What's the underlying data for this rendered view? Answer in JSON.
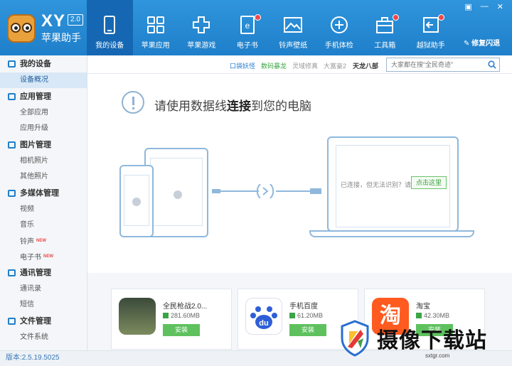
{
  "app": {
    "logo_text": "XY",
    "version_badge": "2.0",
    "name": "苹果助手",
    "fix_flash": "修复闪退"
  },
  "window_controls": [
    "▣",
    "—",
    "✕"
  ],
  "nav": [
    {
      "label": "我的设备",
      "icon": "device-icon",
      "active": true,
      "dot": false
    },
    {
      "label": "苹果应用",
      "icon": "apps-grid-icon",
      "active": false,
      "dot": false
    },
    {
      "label": "苹果游戏",
      "icon": "gamepad-icon",
      "active": false,
      "dot": false
    },
    {
      "label": "电子书",
      "icon": "ebook-icon",
      "active": false,
      "dot": true
    },
    {
      "label": "铃声壁纸",
      "icon": "wallpaper-icon",
      "active": false,
      "dot": false
    },
    {
      "label": "手机体检",
      "icon": "checkup-icon",
      "active": false,
      "dot": false
    },
    {
      "label": "工具箱",
      "icon": "toolbox-icon",
      "active": false,
      "dot": true
    },
    {
      "label": "越狱助手",
      "icon": "jailbreak-icon",
      "active": false,
      "dot": true
    }
  ],
  "sidebar": [
    {
      "title": "我的设备",
      "items": [
        {
          "label": "设备概况",
          "active": true
        }
      ]
    },
    {
      "title": "应用管理",
      "items": [
        {
          "label": "全部应用"
        },
        {
          "label": "应用升级"
        }
      ]
    },
    {
      "title": "图片管理",
      "items": [
        {
          "label": "相机照片"
        },
        {
          "label": "其他照片"
        }
      ]
    },
    {
      "title": "多媒体管理",
      "items": [
        {
          "label": "视频"
        },
        {
          "label": "音乐"
        },
        {
          "label": "铃声",
          "new": "NEW"
        },
        {
          "label": "电子书",
          "new": "NEW"
        }
      ]
    },
    {
      "title": "通讯管理",
      "items": [
        {
          "label": "通讯录"
        },
        {
          "label": "短信"
        }
      ]
    },
    {
      "title": "文件管理",
      "items": [
        {
          "label": "文件系统"
        }
      ]
    }
  ],
  "quick_links": [
    {
      "label": "口袋妖怪",
      "color": "#2e7fd1"
    },
    {
      "label": "数码暴龙",
      "color": "#3aa545"
    },
    {
      "label": "灵域修真",
      "color": "#999999"
    },
    {
      "label": "大富豪2",
      "color": "#999999"
    },
    {
      "label": "天龙八部",
      "color": "#333333"
    }
  ],
  "search": {
    "placeholder": "大家都在搜“全民奇迹”"
  },
  "main": {
    "notice_prefix": "请使用数据线",
    "notice_bold": "连接",
    "notice_suffix": "到您的电脑",
    "connect_hint": "已连接，但无法识别？请",
    "connect_button": "点击这里"
  },
  "apps": [
    {
      "name": "全民枪战2.0...",
      "size": "281.60MB",
      "install": "安装",
      "icon": "game-soldier-icon"
    },
    {
      "name": "手机百度",
      "size": "61.20MB",
      "install": "安装",
      "icon": "baidu-icon"
    },
    {
      "name": "淘宝",
      "size": "42.30MB",
      "install": "安装",
      "icon": "taobao-icon"
    }
  ],
  "footer": {
    "version": "版本:2.5.19.5025"
  },
  "watermark": {
    "title": "摄像下载站",
    "url": "sxtgr.com"
  },
  "colors": {
    "header": "#1f7fca",
    "active_nav": "#1567b3",
    "install_green": "#5ec15e",
    "accent_red": "#f04848"
  }
}
